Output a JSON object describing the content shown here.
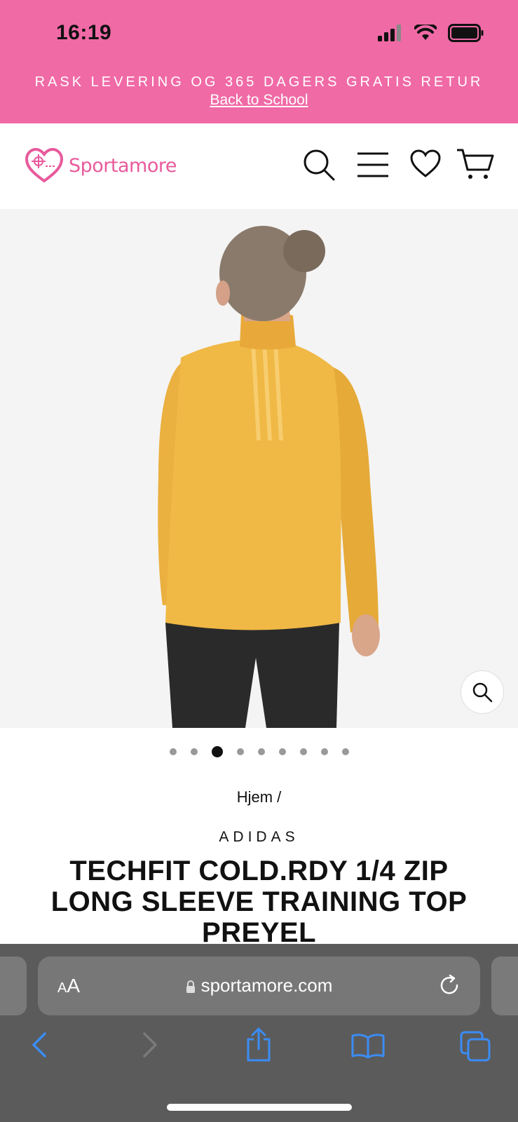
{
  "status_bar": {
    "time": "16:19"
  },
  "promo": {
    "text": "RASK LEVERING OG 365 DAGERS GRATIS RETUR",
    "link": "Back to School",
    "background_color": "#f06aa6"
  },
  "header": {
    "logo_text": "Sportamore",
    "brand_color": "#e85a9c",
    "icons": [
      "search-icon",
      "menu-icon",
      "heart-icon",
      "cart-icon"
    ]
  },
  "gallery": {
    "dots_total": 9,
    "active_dot": 3
  },
  "product": {
    "breadcrumb": "Hjem /",
    "brand": "ADIDAS",
    "title": "TECHFIT COLD.RDY 1/4 ZIP LONG SLEEVE TRAINING TOP PREYEL"
  },
  "browser": {
    "aa_label_small": "A",
    "aa_label_large": "A",
    "url": "sportamore.com",
    "accent_color": "#3b8cf5"
  }
}
